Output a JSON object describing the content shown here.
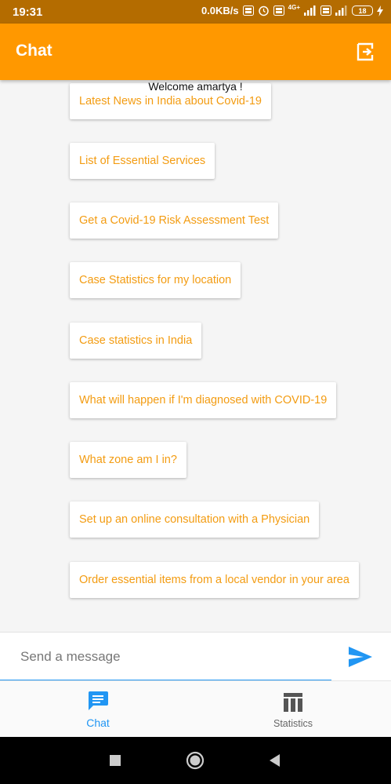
{
  "status_bar": {
    "time": "19:31",
    "net_speed": "0.0KB/s",
    "sim1_type": "4G+",
    "battery": "18"
  },
  "app_bar": {
    "title": "Chat",
    "logout_icon": "logout-icon"
  },
  "chat": {
    "welcome": "Welcome amartya !",
    "suggestions": [
      "Latest News in India about Covid-19",
      "List of Essential Services",
      "Get a Covid-19 Risk Assessment Test",
      "Case Statistics for my location",
      "Case statistics in India",
      "What will happen if I'm diagnosed with COVID-19",
      "What zone am I in?",
      "Set up an online consultation with a Physician",
      "Order essential items from a local vendor in your area"
    ]
  },
  "input": {
    "placeholder": "Send a message",
    "send_icon": "send-icon"
  },
  "bottom_nav": {
    "chat_label": "Chat",
    "stats_label": "Statistics"
  },
  "colors": {
    "primary": "#ff9800",
    "status_bar": "#b46c00",
    "accent_blue": "#2196f3",
    "suggestion_text": "#f39c12"
  }
}
